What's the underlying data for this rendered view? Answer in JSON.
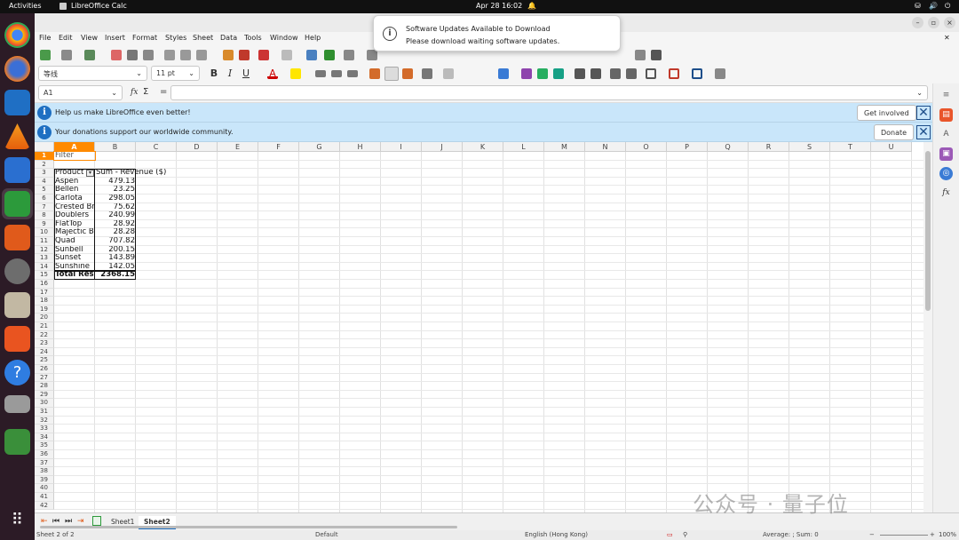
{
  "topbar": {
    "activities": "Activities",
    "app_name": "LibreOffice Calc",
    "clock": "Apr 28  16:02"
  },
  "menu": [
    "File",
    "Edit",
    "View",
    "Insert",
    "Format",
    "Styles",
    "Sheet",
    "Data",
    "Tools",
    "Window",
    "Help"
  ],
  "notification": {
    "title": "Software Updates Available to Download",
    "body": "Please download waiting software updates."
  },
  "formatting": {
    "font_name": "等线",
    "font_size": "11 pt"
  },
  "formula_bar": {
    "name_box": "A1",
    "formula": ""
  },
  "infobars": [
    {
      "text": "Help us make LibreOffice even better!",
      "button": "Get involved"
    },
    {
      "text": "Your donations support our worldwide community.",
      "button": "Donate"
    }
  ],
  "columns": [
    "A",
    "B",
    "C",
    "D",
    "E",
    "F",
    "G",
    "H",
    "I",
    "J",
    "K",
    "L",
    "M",
    "N",
    "O",
    "P",
    "Q",
    "R",
    "S",
    "T",
    "U"
  ],
  "rows": [
    "1",
    "2",
    "3",
    "4",
    "5",
    "6",
    "7",
    "8",
    "9",
    "10",
    "11",
    "12",
    "13",
    "14",
    "15",
    "16",
    "17",
    "18",
    "19",
    "20",
    "21",
    "22",
    "23",
    "24",
    "25",
    "26",
    "27",
    "28",
    "29",
    "30",
    "31",
    "32",
    "33",
    "34",
    "35",
    "36",
    "37",
    "38",
    "39",
    "40",
    "41",
    "42"
  ],
  "pivot": {
    "filter_label": "Filter",
    "header_product": "Product",
    "header_sum": "Sum - Revenue ($)",
    "rows": [
      {
        "product": "Aspen",
        "value": "479.13"
      },
      {
        "product": "Bellen",
        "value": "23.25"
      },
      {
        "product": "Carlota",
        "value": "298.05"
      },
      {
        "product": "Crested Br",
        "value": "75.62"
      },
      {
        "product": "Doublers",
        "value": "240.99"
      },
      {
        "product": "FlatTop",
        "value": "28.92"
      },
      {
        "product": "Majectic B",
        "value": "28.28"
      },
      {
        "product": "Quad",
        "value": "707.82"
      },
      {
        "product": "Sunbell",
        "value": "200.15"
      },
      {
        "product": "Sunset",
        "value": "143.89"
      },
      {
        "product": "Sunshine",
        "value": "142.05"
      }
    ],
    "total_label": "Total Res",
    "total_value": "2368.15"
  },
  "sheets": [
    {
      "name": "Sheet1",
      "active": false
    },
    {
      "name": "Sheet2",
      "active": true
    }
  ],
  "status": {
    "sheet_pos": "Sheet 2 of 2",
    "page_style": "Default",
    "language": "English (Hong Kong)",
    "summary": "Average: ; Sum: 0",
    "zoom": "100%"
  },
  "watermark": "公众号 · 量子位",
  "colors": {
    "accent": "#1e6fc2",
    "infobar": "#c9e6fa",
    "dock": "#2c1b26",
    "selected_cell": "#ff8a00"
  }
}
